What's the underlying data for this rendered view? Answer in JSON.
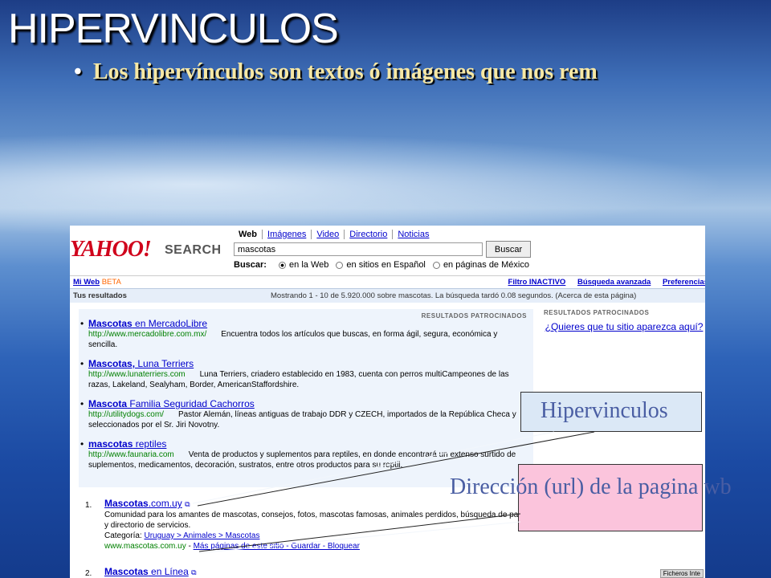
{
  "slide": {
    "title": "HIPERVINCULOS",
    "bullet": "Los hipervínculos son textos ó imágenes que nos rem"
  },
  "yahoo": {
    "logo": "YAHOO!",
    "logo_sub": "SEARCH",
    "tabs": [
      "Web",
      "Imágenes",
      "Video",
      "Directorio",
      "Noticias"
    ],
    "search_value": "mascotas",
    "search_button": "Buscar",
    "buscar_label": "Buscar:",
    "radio_options": [
      "en la Web",
      "en sitios en Español",
      "en páginas de México"
    ],
    "toolbar_left_link": "Mi Web",
    "toolbar_left_badge": "BETA",
    "toolbar_right": [
      "Filtro INACTIVO",
      "Búsqueda avanzada",
      "Preferencias"
    ],
    "results_label": "Tus resultados",
    "results_info": "Mostrando 1 - 10 de 5.920.000 sobre mascotas. La búsqueda tardó 0.08 segundos. (Acerca de esta página)",
    "sponsored_header": "RESULTADOS PATROCINADOS",
    "ads": [
      {
        "title_bold": "Mascotas",
        "title_rest": " en MercadoLibre",
        "url": "http://www.mercadolibre.com.mx/",
        "desc": "Encuentra todos los artículos que buscas, en forma ágil, segura, económica y sencilla."
      },
      {
        "title_bold": "Mascotas,",
        "title_rest": " Luna Terriers",
        "url": "http://www.lunaterriers.com",
        "desc": "Luna Terriers, criadero establecido en 1983, cuenta con perros multiCampeones de las razas, Lakeland, Sealyham, Border, AmericanStaffordshire."
      },
      {
        "title_bold": "Mascota",
        "title_rest": " Familia Seguridad Cachorros",
        "url": "http://utilitydogs.com/",
        "desc": "Pastor Alemán, líneas antiguas de trabajo DDR y CZECH, importados de la República Checa y seleccionados por el Sr. Jiri Novotny."
      },
      {
        "title_bold": "mascotas",
        "title_rest": " reptiles",
        "url": "http://www.faunaria.com",
        "desc": "Venta de productos y suplementos para reptiles, en donde encontrará un extenso surtido de suplementos, medicamentos, decoración, sustratos, entre otros productos para su reptil."
      }
    ],
    "right_header": "RESULTADOS PATROCINADOS",
    "right_link": "¿Quieres que tu sitio aparezca aquí?",
    "organic": [
      {
        "num": "1.",
        "title_bold": "Mascotas",
        "title_rest": ".com.uy",
        "desc": "Comunidad para los amantes de mascotas, consejos, fotos, mascotas famosas, animales perdidos, búsqueda de pareja y directorio de servicios.",
        "cat_label": "Categoría:",
        "cat_path": "Uruguay > Animales > Mascotas",
        "url": "www.mascotas.com.uy",
        "links": "Más páginas de este sitio - Guardar - Bloquear"
      },
      {
        "num": "2.",
        "title_bold": "Mascotas",
        "title_rest": " en Línea"
      }
    ],
    "window_tab": "Ficheros  Inte"
  },
  "callouts": {
    "hyperlinks": "Hipervinculos",
    "url": "Dirección (url) de la pagina wb"
  }
}
